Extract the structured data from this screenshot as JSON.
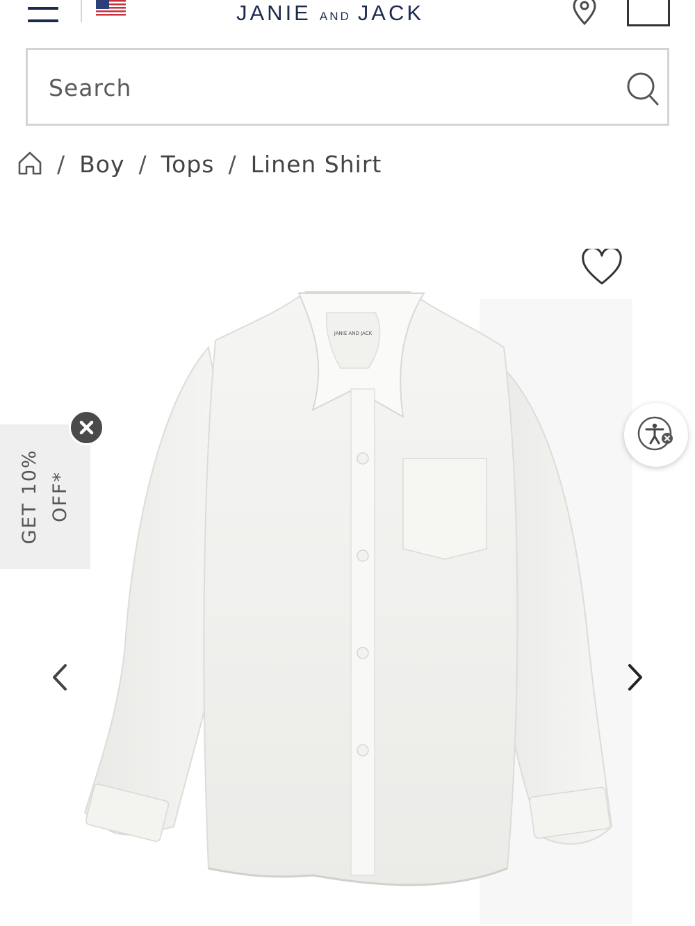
{
  "header": {
    "brand_left": "JANIE",
    "brand_mid": "AND",
    "brand_right": "JACK",
    "menu_icon": "hamburger-menu-icon",
    "flag_icon": "us-flag-icon",
    "store_icon": "location-pin-icon",
    "bag_icon": "shopping-bag-icon",
    "brand_color": "#1b2a4e"
  },
  "search": {
    "placeholder": "Search",
    "value": "",
    "icon": "search-icon"
  },
  "breadcrumb": {
    "home_icon": "home-icon",
    "items": [
      "Boy",
      "Tops",
      "Linen Shirt"
    ],
    "separator": "/"
  },
  "product": {
    "image": "white-linen-shirt",
    "collar_tag": "JANIE AND JACK",
    "favorite_icon": "heart-icon",
    "prev_icon": "chevron-left-icon",
    "next_icon": "chevron-right-icon"
  },
  "promo": {
    "line1": "GET 10%",
    "line2": "OFF*",
    "close_icon": "close-icon"
  },
  "accessibility": {
    "icon": "accessibility-icon"
  }
}
